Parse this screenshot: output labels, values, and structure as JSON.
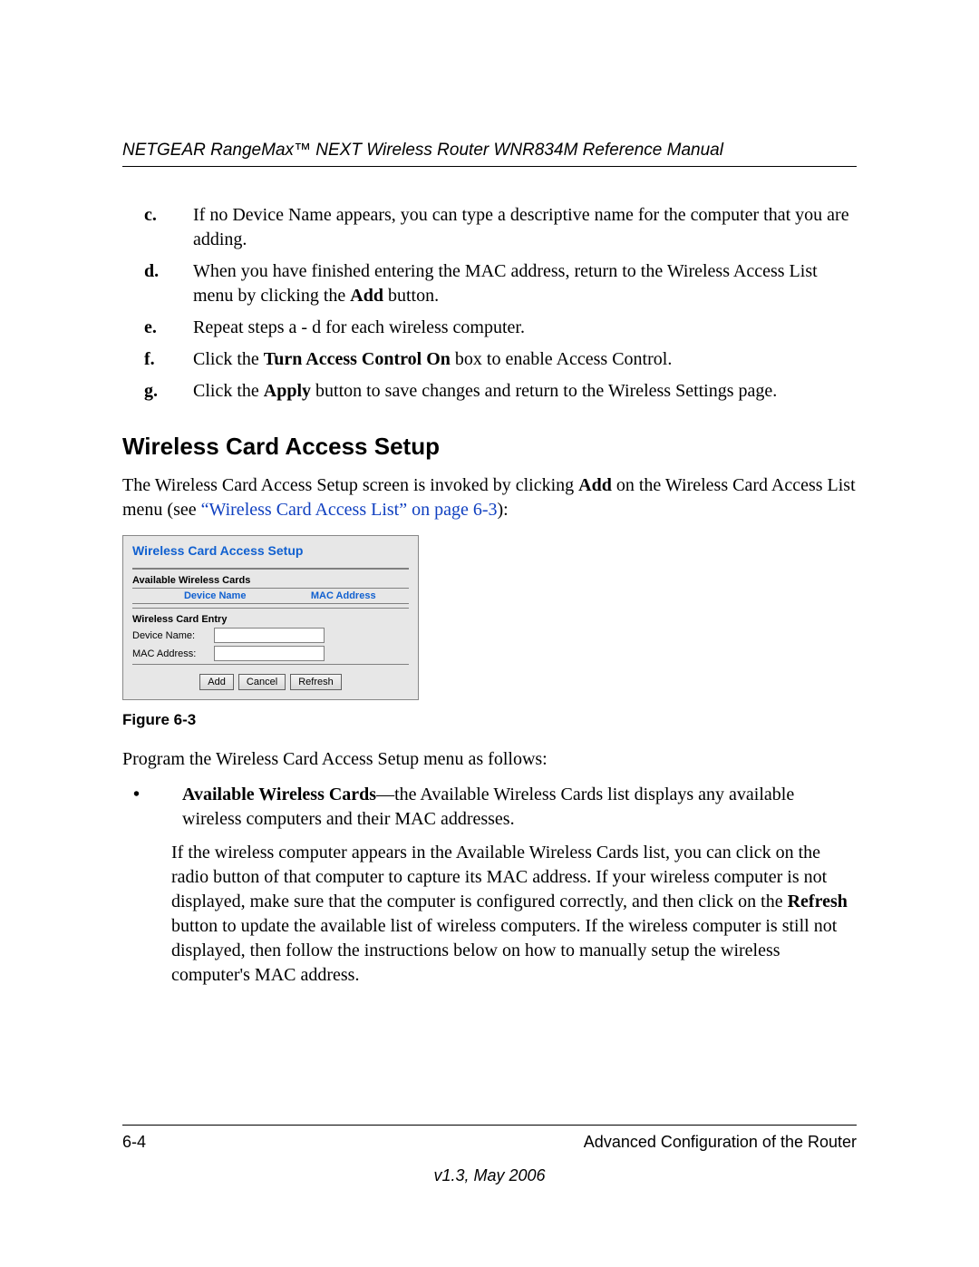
{
  "header": {
    "running": "NETGEAR RangeMax™ NEXT Wireless Router WNR834M Reference Manual"
  },
  "steps": {
    "c": {
      "label": "c.",
      "text_before": "If no Device Name appears, you can type a descriptive name for the computer that you are adding."
    },
    "d": {
      "label": "d.",
      "text_before": "When you have finished entering the MAC address, return to the Wireless Access List menu by clicking the ",
      "bold": "Add",
      "text_after": " button."
    },
    "e": {
      "label": "e.",
      "text_before": "Repeat steps a - d for each wireless computer."
    },
    "f": {
      "label": "f.",
      "text_before": "Click the ",
      "bold": "Turn Access Control On",
      "text_after": " box to enable Access Control."
    },
    "g": {
      "label": "g.",
      "text_before": "Click the ",
      "bold": "Apply",
      "text_after": " button to save changes and return to the Wireless Settings page."
    }
  },
  "section": {
    "title": "Wireless Card Access Setup",
    "intro_before": "The Wireless Card Access Setup screen is invoked by clicking ",
    "intro_bold": "Add",
    "intro_mid": " on the Wireless Card Access List menu (see ",
    "intro_link": "“Wireless Card Access List” on page 6-3",
    "intro_after": "):"
  },
  "figure": {
    "title": "Wireless Card Access Setup",
    "available_label": "Available Wireless Cards",
    "col_device": "Device Name",
    "col_mac": "MAC Address",
    "entry_header": "Wireless Card Entry",
    "device_label": "Device Name:",
    "mac_label": "MAC Address:",
    "btn_add": "Add",
    "btn_cancel": "Cancel",
    "btn_refresh": "Refresh",
    "caption": "Figure 6-3"
  },
  "post_figure": {
    "intro": "Program the Wireless Card Access Setup menu as follows:",
    "bullet_bold": "Available Wireless Cards",
    "bullet_after": "—the Available Wireless Cards list displays any available wireless computers and their MAC addresses.",
    "cont_before": "If the wireless computer appears in the Available Wireless Cards list, you can click on the radio button of that computer to capture its MAC address. If your wireless computer is not displayed, make sure that the computer is configured correctly, and then click on the ",
    "cont_bold": "Refresh",
    "cont_after": " button to update the available list of wireless computers. If the wireless computer is still not displayed, then follow the instructions below on how to manually setup the wireless computer's MAC address."
  },
  "footer": {
    "page": "6-4",
    "chapter": "Advanced Configuration of the Router",
    "version": "v1.3, May 2006"
  }
}
